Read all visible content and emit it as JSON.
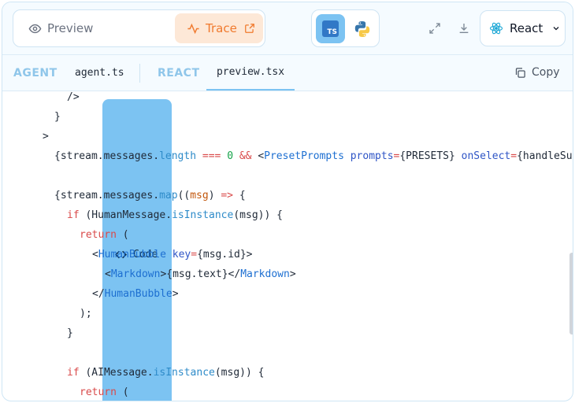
{
  "toolbar": {
    "preview_label": "Preview",
    "code_label": "Code",
    "trace_label": "Trace",
    "framework_label": "React",
    "colors": {
      "code_active": "#7cc3f2",
      "trace_bg": "#fde8d7",
      "trace_fg": "#f07a2e"
    },
    "icons": [
      "eye-icon",
      "code-brackets-icon",
      "activity-icon",
      "external-link-icon",
      "typescript-icon",
      "python-icon",
      "expand-icon",
      "download-icon",
      "react-icon",
      "chevron-down-icon"
    ]
  },
  "tabs": {
    "agent_group": "AGENT",
    "agent_file": "agent.ts",
    "react_group": "REACT",
    "react_file": "preview.tsx",
    "copy_label": "Copy"
  },
  "code": {
    "l1": "/>",
    "l2": "}",
    "l3": ">",
    "l4a": "{stream.",
    "l4b": "messages",
    "l4c": ".",
    "l4d": "length",
    "l4e": " === ",
    "l4f": "0",
    "l4g": " && ",
    "l4h": "<",
    "l4i": "PresetPrompts",
    "l4j": " prompts",
    "l4k": "=",
    "l4l": "{PRESETS}",
    "l4m": " onSelect",
    "l4n": "=",
    "l4o": "{handleSu",
    "l5a": "{stream.",
    "l5b": "messages",
    "l5c": ".",
    "l5d": "map",
    "l5e": "((",
    "l5f": "msg",
    "l5g": ") ",
    "l5h": "=>",
    "l5i": " {",
    "l6a": "if",
    "l6b": " (HumanMessage.",
    "l6c": "isInstance",
    "l6d": "(msg)) {",
    "l7a": "return",
    "l7b": " (",
    "l8a": "<",
    "l8b": "HumanBubble",
    "l8c": " key",
    "l8d": "=",
    "l8e": "{msg.id}>",
    "l9a": "<",
    "l9b": "Markdown",
    "l9c": ">{msg.text}</",
    "l9d": "Markdown",
    "l9e": ">",
    "l10a": "</",
    "l10b": "HumanBubble",
    "l10c": ">",
    "l11": ");",
    "l12": "}",
    "l13a": "if",
    "l13b": " (AIMessage.",
    "l13c": "isInstance",
    "l13d": "(msg)) {",
    "l14a": "return",
    "l14b": " ("
  }
}
